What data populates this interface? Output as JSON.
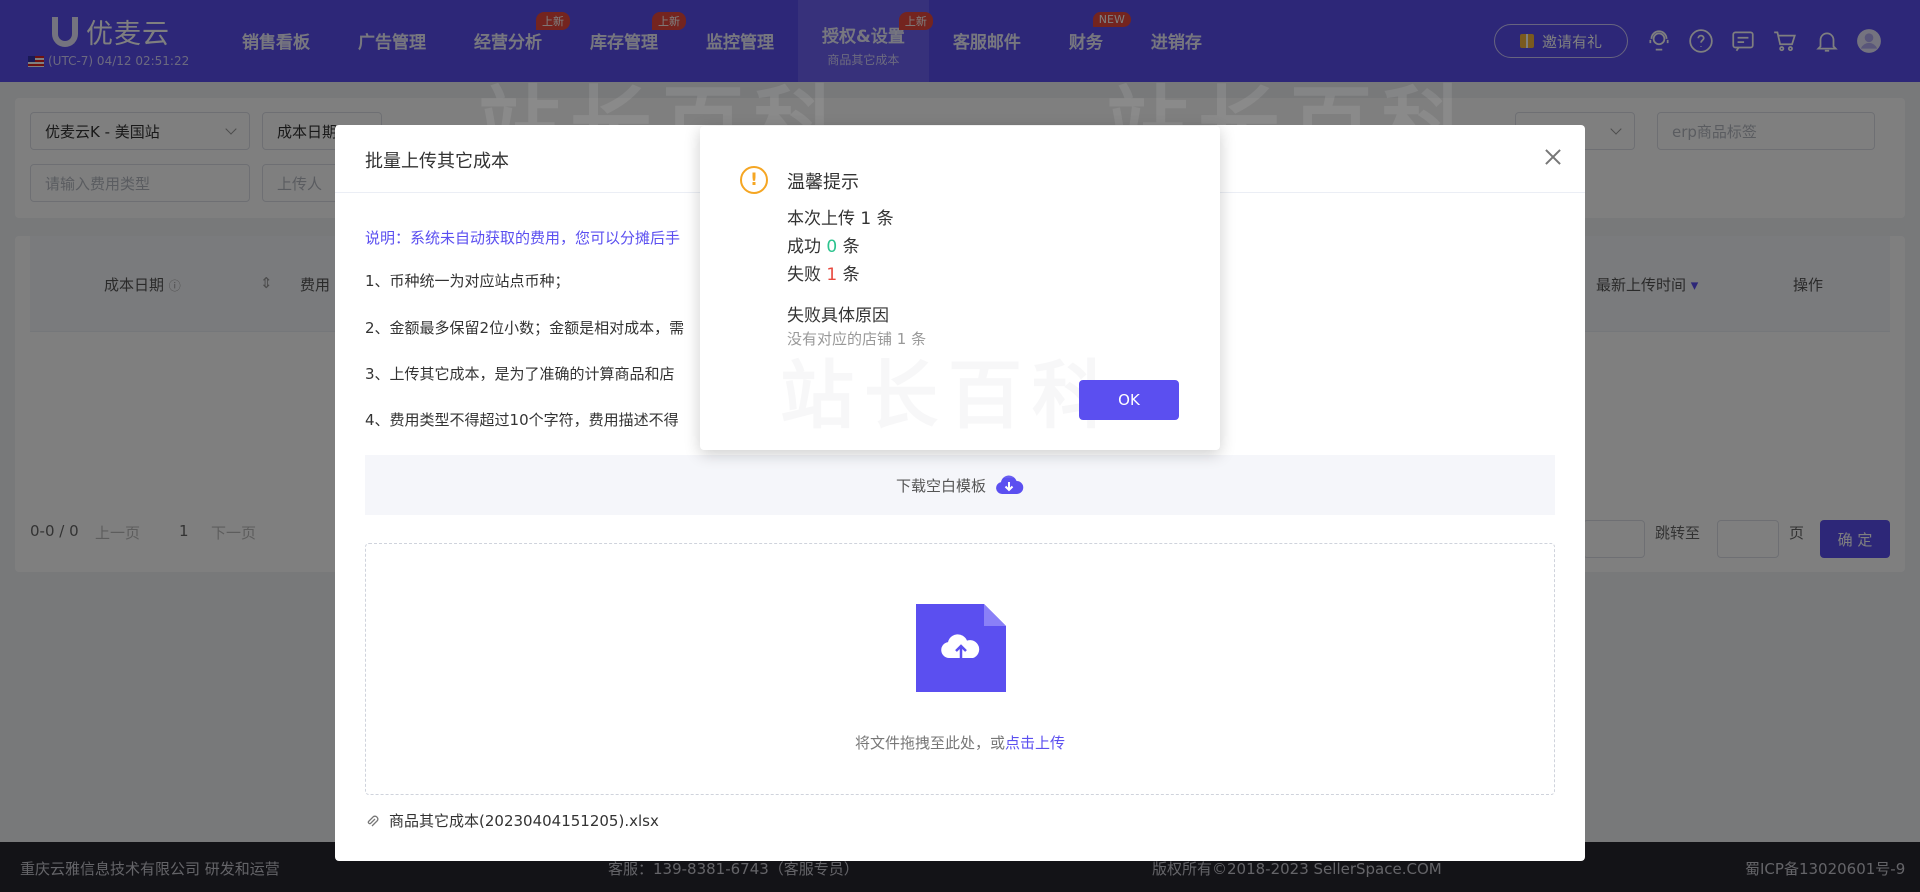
{
  "app": {
    "logo_text": "优麦云",
    "timezone": "(UTC-7) 04/12 02:51:22"
  },
  "nav": [
    {
      "label": "销售看板",
      "badge": ""
    },
    {
      "label": "广告管理",
      "badge": ""
    },
    {
      "label": "经营分析",
      "badge": "上新"
    },
    {
      "label": "库存管理",
      "badge": "上新"
    },
    {
      "label": "监控管理",
      "badge": ""
    },
    {
      "label": "授权&设置",
      "badge": "上新",
      "sub": "商品其它成本"
    },
    {
      "label": "客服邮件",
      "badge": ""
    },
    {
      "label": "财务",
      "badge": "NEW"
    },
    {
      "label": "进销存",
      "badge": ""
    }
  ],
  "header": {
    "invite_label": "邀请有礼"
  },
  "filters": {
    "shop_select": "优麦云K - 美国站",
    "date_field": "成本日期",
    "erp_title_placeholder": "erp商品标签",
    "fee_type_placeholder": "请输入费用类型",
    "uploader_placeholder": "上传人"
  },
  "table": {
    "col_cost_date": "成本日期",
    "col_fee": "费用",
    "col_upload_time": "最新上传时间",
    "col_action": "操作"
  },
  "pager": {
    "range": "0-0 / 0",
    "prev": "上一页",
    "page": "1",
    "next": "下一页",
    "goto_label": "跳转至",
    "page_unit": "页",
    "confirm": "确 定"
  },
  "footer": {
    "company": "重庆云雅信息技术有限公司 研发和运营",
    "service": "客服：139-8381-6743（客服专员）",
    "copyright": "版权所有©2018-2023 SellerSpace.COM",
    "icp": "蜀ICP备13020601号-9"
  },
  "dialog": {
    "title": "批量上传其它成本",
    "note": "说明：系统未自动获取的费用，您可以分摊后手",
    "rules": [
      "1、币种统一为对应站点币种；",
      "2、金额最多保留2位小数；金额是相对成本，需",
      "3、上传其它成本，是为了准确的计算商品和店",
      "4、费用类型不得超过10个字符，费用描述不得"
    ],
    "template_label": "下载空白模板",
    "drop_text": "将文件拖拽至此处，或",
    "drop_link": "点击上传",
    "file_name": "商品其它成本(20230404151205).xlsx"
  },
  "watermark": "站长百科",
  "alert": {
    "title": "温馨提示",
    "line1": "本次上传 1 条",
    "success_prefix": "成功 ",
    "success_count": "0",
    "success_suffix": " 条",
    "fail_prefix": "失败 ",
    "fail_count": "1",
    "fail_suffix": " 条",
    "reason_label": "失败具体原因",
    "reason_detail": "没有对应的店铺 1 条",
    "ok_label": "OK"
  },
  "colors": {
    "brand": "#5b4ff0",
    "success": "#2cc38e",
    "danger": "#e8493f",
    "warning": "#f5a623"
  }
}
